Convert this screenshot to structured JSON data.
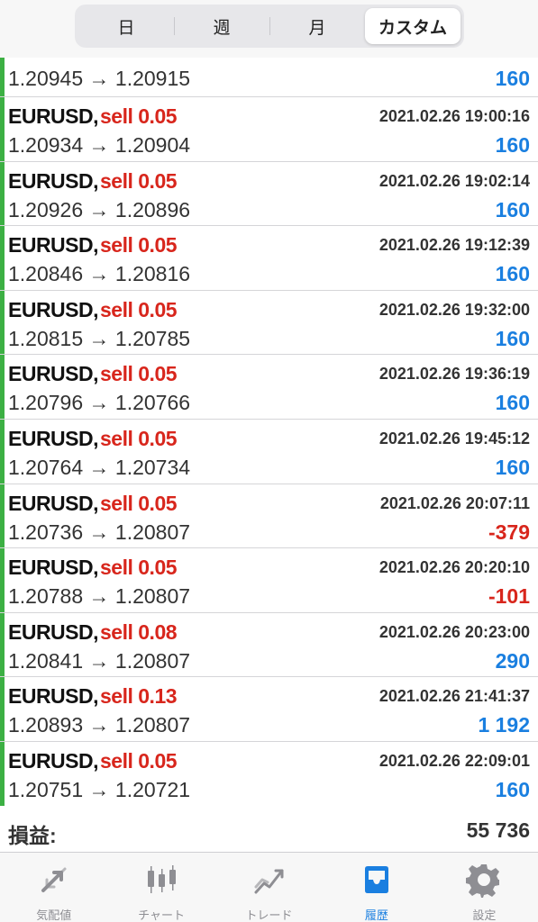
{
  "segments": [
    {
      "label": "日",
      "active": false
    },
    {
      "label": "週",
      "active": false
    },
    {
      "label": "月",
      "active": false
    },
    {
      "label": "カスタム",
      "active": true
    }
  ],
  "trades": [
    {
      "symbol": "EURUSD,",
      "side": "sell 0.05",
      "time": "",
      "prices": "1.20945 → 1.20915",
      "profit": "160",
      "positive": true
    },
    {
      "symbol": "EURUSD,",
      "side": "sell 0.05",
      "time": "2021.02.26 19:00:16",
      "prices": "1.20934 → 1.20904",
      "profit": "160",
      "positive": true
    },
    {
      "symbol": "EURUSD,",
      "side": "sell 0.05",
      "time": "2021.02.26 19:02:14",
      "prices": "1.20926 → 1.20896",
      "profit": "160",
      "positive": true
    },
    {
      "symbol": "EURUSD,",
      "side": "sell 0.05",
      "time": "2021.02.26 19:12:39",
      "prices": "1.20846 → 1.20816",
      "profit": "160",
      "positive": true
    },
    {
      "symbol": "EURUSD,",
      "side": "sell 0.05",
      "time": "2021.02.26 19:32:00",
      "prices": "1.20815 → 1.20785",
      "profit": "160",
      "positive": true
    },
    {
      "symbol": "EURUSD,",
      "side": "sell 0.05",
      "time": "2021.02.26 19:36:19",
      "prices": "1.20796 → 1.20766",
      "profit": "160",
      "positive": true
    },
    {
      "symbol": "EURUSD,",
      "side": "sell 0.05",
      "time": "2021.02.26 19:45:12",
      "prices": "1.20764 → 1.20734",
      "profit": "160",
      "positive": true
    },
    {
      "symbol": "EURUSD,",
      "side": "sell 0.05",
      "time": "2021.02.26 20:07:11",
      "prices": "1.20736 → 1.20807",
      "profit": "-379",
      "positive": false
    },
    {
      "symbol": "EURUSD,",
      "side": "sell 0.05",
      "time": "2021.02.26 20:20:10",
      "prices": "1.20788 → 1.20807",
      "profit": "-101",
      "positive": false
    },
    {
      "symbol": "EURUSD,",
      "side": "sell 0.08",
      "time": "2021.02.26 20:23:00",
      "prices": "1.20841 → 1.20807",
      "profit": "290",
      "positive": true
    },
    {
      "symbol": "EURUSD,",
      "side": "sell 0.13",
      "time": "2021.02.26 21:41:37",
      "prices": "1.20893 → 1.20807",
      "profit": "1 192",
      "positive": true
    },
    {
      "symbol": "EURUSD,",
      "side": "sell 0.05",
      "time": "2021.02.26 22:09:01",
      "prices": "1.20751 → 1.20721",
      "profit": "160",
      "positive": true
    }
  ],
  "summary": {
    "label": "損益:",
    "value": "55 736"
  },
  "tabs": [
    {
      "label": "気配値",
      "icon": "quotes-icon",
      "active": false
    },
    {
      "label": "チャート",
      "icon": "chart-icon",
      "active": false
    },
    {
      "label": "トレード",
      "icon": "trade-icon",
      "active": false
    },
    {
      "label": "履歴",
      "icon": "history-icon",
      "active": true
    },
    {
      "label": "設定",
      "icon": "settings-icon",
      "active": false
    }
  ],
  "colors": {
    "accent": "#1a7fe0",
    "loss": "#d8261c",
    "row_marker": "#3cb043"
  }
}
